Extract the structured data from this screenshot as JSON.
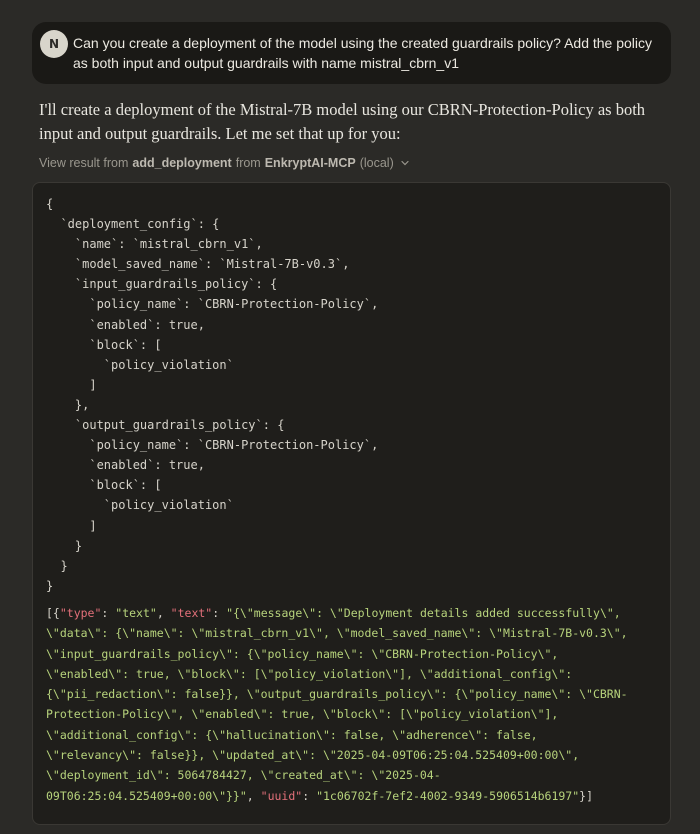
{
  "user_message": {
    "avatar_initial": "N",
    "text": "Can you create a deployment of the model using the created guardrails policy? Add the policy as both input and output guardrails with name mistral_cbrn_v1"
  },
  "assistant_reply": {
    "text": "I'll create a deployment of the Mistral-7B model using our CBRN-Protection-Policy as both input and output guardrails. Let me set that up for you:"
  },
  "tool_result": {
    "prefix": "View result from",
    "tool_name": "add_deployment",
    "from_word": "from",
    "server_name": "EnkryptAI-MCP",
    "suffix": "(local)",
    "chevron_icon": "chevron-down-icon"
  },
  "code_block": {
    "lines": [
      "{",
      "  `deployment_config`: {",
      "    `name`: `mistral_cbrn_v1`,",
      "    `model_saved_name`: `Mistral-7B-v0.3`,",
      "    `input_guardrails_policy`: {",
      "      `policy_name`: `CBRN-Protection-Policy`,",
      "      `enabled`: true,",
      "      `block`: [",
      "        `policy_violation`",
      "      ]",
      "    },",
      "    `output_guardrails_policy`: {",
      "      `policy_name`: `CBRN-Protection-Policy`,",
      "      `enabled`: true,",
      "      `block`: [",
      "        `policy_violation`",
      "      ]",
      "    }",
      "  }",
      "}"
    ]
  },
  "raw_result": {
    "open": "[{",
    "k_type": "\"type\"",
    "sep1": ": ",
    "v_type": "\"text\"",
    "comma1": ", ",
    "k_text": "\"text\"",
    "sep2": ": ",
    "text_value_lines": [
      "\"{\\\"message\\\": \\\"Deployment details added successfully\\\",",
      "\\\"data\\\": {\\\"name\\\": \\\"mistral_cbrn_v1\\\", \\\"model_saved_name\\\": \\\"Mistral-7B-v0.3\\\",",
      "\\\"input_guardrails_policy\\\": {\\\"policy_name\\\": \\\"CBRN-Protection-Policy\\\",",
      "\\\"enabled\\\": true, \\\"block\\\": [\\\"policy_violation\\\"], \\\"additional_config\\\":",
      "{\\\"pii_redaction\\\": false}}, \\\"output_guardrails_policy\\\": {\\\"policy_name\\\": \\\"CBRN-",
      "Protection-Policy\\\", \\\"enabled\\\": true, \\\"block\\\": [\\\"policy_violation\\\"],",
      "\\\"additional_config\\\": {\\\"hallucination\\\": false, \\\"adherence\\\": false,",
      "\\\"relevancy\\\": false}}, \\\"updated_at\\\": \\\"2025-04-09T06:25:04.525409+00:00\\\",",
      "\\\"deployment_id\\\": 5064784427, \\\"created_at\\\": \\\"2025-04-",
      "09T06:25:04.525409+00:00\\\"}}\""
    ],
    "comma2": ", ",
    "k_uuid": "\"uuid\"",
    "sep3": ": ",
    "v_uuid": "\"1c06702f-7ef2-4002-9349-5906514b6197\"",
    "close": "}]"
  }
}
